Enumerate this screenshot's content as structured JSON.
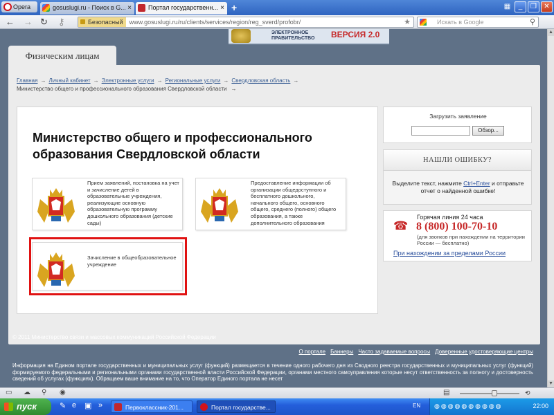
{
  "browser": {
    "menu_label": "Opera",
    "tabs": [
      {
        "title": "gosuslugi.ru - Поиск в G..."
      },
      {
        "title": "Портал государственн..."
      }
    ],
    "new_tab": "+",
    "security_label": "Безопасный",
    "url": "www.gosuslugi.ru/ru/clients/services/region/reg_sverd/profobr/",
    "search_placeholder": "Искать в Google"
  },
  "banner": {
    "gov_line1": "ЭЛЕКТРОННОЕ",
    "gov_line2": "ПРАВИТЕЛЬСТВО",
    "version": "ВЕРСИЯ 2.0"
  },
  "section_tab": "Физическим лицам",
  "breadcrumbs": {
    "links": [
      "Главная",
      "Личный кабинет",
      "Электронные услуги",
      "Региональные услуги",
      "Свердловская область"
    ],
    "current": "Министерство общего и профессионального образования Свердловской области",
    "arrow": "→"
  },
  "main": {
    "title": "Министерство общего и профессионального образования Свердловской области",
    "services": [
      {
        "text": "Прием заявлений, постановка на учет и зачисление детей в образовательные учреждения, реализующие основную образовательную программу дошкольного образования (детские сады)"
      },
      {
        "text": "Предоставление информации об организации общедоступного и бесплатного дошкольного, начального общего, основного общего, среднего (полного) общего образования, а также дополнительного образования"
      },
      {
        "text": "Зачисление в общеобразовательное учреждение"
      }
    ]
  },
  "sidebar": {
    "upload_title": "Загрузить заявление",
    "browse_button": "Обзор...",
    "error_header": "НАШЛИ ОШИБКУ?",
    "error_text_before": "Выделите текст, нажмите ",
    "error_shortcut": "Ctrl+Enter",
    "error_text_after": " и отправьте отчет о найденной ошибке!",
    "hotline_label": "Горячая линия 24 часа",
    "hotline_number": "8 (800) 100-70-10",
    "hotline_note": "(для звонков при нахождении на территории России — бесплатно)",
    "abroad_link": "При нахождении за пределами России"
  },
  "footer": {
    "copyright": "© 2011 Министерство связи и массовых коммуникаций Российской Федерации",
    "links": [
      "О портале",
      "Баннеры",
      "Часто задаваемые вопросы",
      "Доверенные удостоверяющие центры"
    ],
    "info": "Информация на Едином портале государственных и муниципальных услуг (функций) размещается в течение одного рабочего дня из Сводного реестра государственных и муниципальных услуг (функций) формируемого федеральными и региональными органами государственной власти Российской Федерации, органами местного самоуправления которые несут ответственность за полноту и достоверность сведений об услугах (функциях). Обращаем ваше внимание на то, что Оператор Единого портала не несет"
  },
  "taskbar": {
    "start_label": "пуск",
    "tasks": [
      {
        "title": "Первоклассник-201..."
      },
      {
        "title": "Портал государстве..."
      }
    ],
    "language": "EN",
    "clock": "22:00"
  },
  "colors": {
    "highlight": "#e01212",
    "hotline": "#c62828",
    "link": "#3b5f94"
  }
}
